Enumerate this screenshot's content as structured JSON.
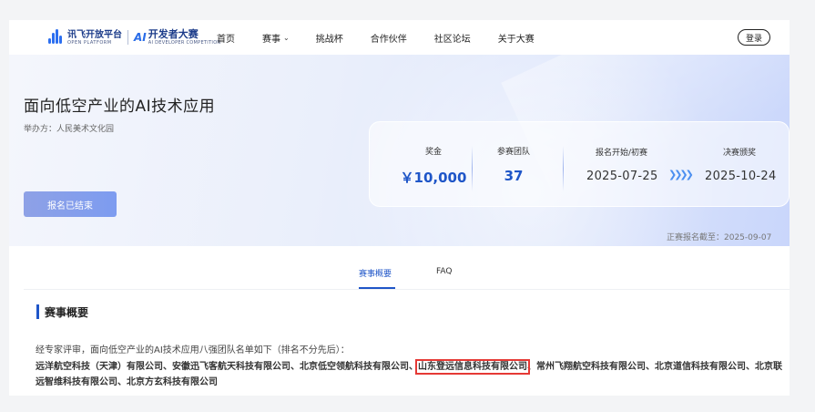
{
  "header": {
    "logo_primary": "讯飞开放平台",
    "logo_primary_sub": "OPEN PLATFORM",
    "logo_ai": "AI",
    "logo_secondary": "开发者大赛",
    "logo_secondary_sub": "AI DEVELOPER COMPETITION",
    "nav": [
      {
        "label": "首页"
      },
      {
        "label": "赛事"
      },
      {
        "label": "挑战杯"
      },
      {
        "label": "合作伙伴"
      },
      {
        "label": "社区论坛"
      },
      {
        "label": "关于大赛"
      }
    ],
    "login_label": "登录"
  },
  "hero": {
    "title": "面向低空产业的AI技术应用",
    "organizer": "举办方：人民美术文化园",
    "status_button": "报名已结束",
    "prize_label": "奖金",
    "prize_value": "￥10,000",
    "teams_label": "参赛团队",
    "teams_value": "37",
    "start_label": "报名开始/初赛",
    "start_value": "2025-07-25",
    "final_label": "决赛颁奖",
    "final_value": "2025-10-24",
    "deadline": "正赛报名截至：2025-09-07"
  },
  "tabs": [
    {
      "label": "赛事概要"
    },
    {
      "label": "FAQ"
    }
  ],
  "content": {
    "section_title": "赛事概要",
    "intro": "经专家评审，面向低空产业的AI技术应用八强团队名单如下（排名不分先后）：",
    "list_part1": "远洋航空科技（天津）有限公司、安徽迅飞客航天科技有限公司、北京低空领航科技有限公司、",
    "list_highlight": "山东登远信息科技有限公司",
    "list_part2": "、常州飞翔航空科技有限公司、北京道信科技有限公司、北京联远智维科技有限公司、北京方玄科技有限公司"
  },
  "colors": {
    "brand_blue": "#1f56c8",
    "highlight_border": "#e53935"
  }
}
